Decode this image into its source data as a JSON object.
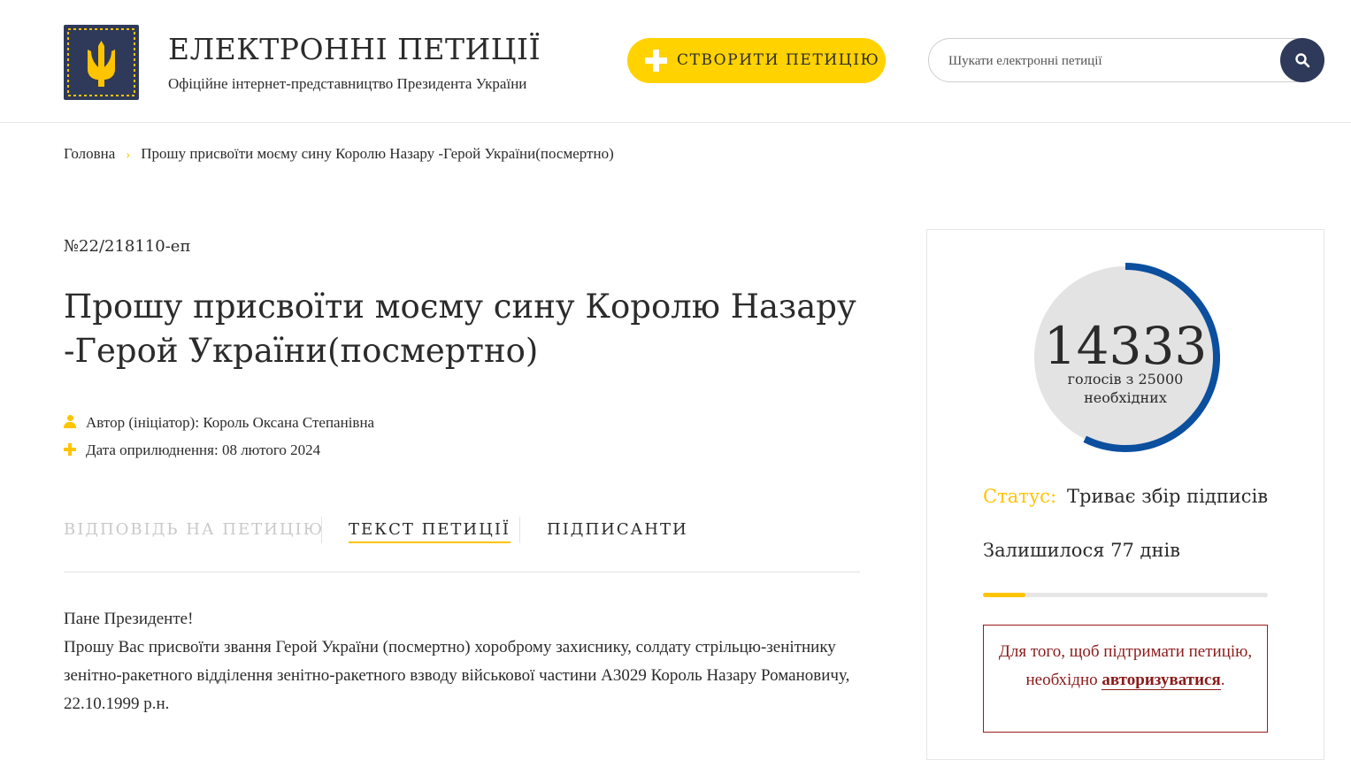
{
  "header": {
    "title": "ЕЛЕКТРОННІ ПЕТИЦІЇ",
    "subtitle": "Офіційне інтернет-представництво Президента України",
    "logo_icon": "trident-emblem-icon",
    "create_button_label": "СТВОРИТИ ПЕТИЦІЮ",
    "search": {
      "placeholder": "Шукати електронні петиції",
      "value": ""
    }
  },
  "breadcrumb": {
    "home": "Головна",
    "current": "Прошу присвоїти моєму сину Королю Назару -Герой України(посмертно)"
  },
  "petition": {
    "number": "№22/218110-еп",
    "title": "Прошу присвоїти моєму сину Королю Назару -Герой України(посмертно)",
    "author_label": "Автор (ініціатор):",
    "author_name": "Король Оксана Степанівна",
    "date_label": "Дата оприлюднення:",
    "date_value": "08 лютого 2024",
    "tabs": [
      {
        "label": "ВІДПОВІДЬ НА ПЕТИЦІЮ",
        "state": "disabled"
      },
      {
        "label": "ТЕКСТ ПЕТИЦІЇ",
        "state": "active"
      },
      {
        "label": "ПІДПИСАНТИ",
        "state": "normal"
      }
    ],
    "body_greeting": "Пане Президенте!",
    "body_text": "Прошу Вас присвоїти звання Герой України (посмертно) хороброму захиснику, солдату стрільцю-зенітнику зенітно-ракетного відділення зенітно-ракетного взводу військової частини А3029 Король Назару Романовичу, 22.10.1999 р.н."
  },
  "sidebar": {
    "votes": "14333",
    "votes_caption_line1": "голосів з 25000",
    "votes_caption_line2": "необхідних",
    "votes_current": 14333,
    "votes_required": 25000,
    "status_label": "Статус:",
    "status_value": "Триває збір підписів",
    "days_left_text": "Залишилося 77 днів",
    "time_progress_fraction": 0.15,
    "auth_text_before": "Для того, щоб підтримати петицію, необхідно",
    "auth_link": "авторизуватися",
    "auth_text_after": "."
  },
  "colors": {
    "accent_yellow": "#ffd200",
    "navy": "#2f3a5a",
    "gauge_blue": "#0b4f9e",
    "gauge_track": "#e3e3e3",
    "error_red": "#8b1a1a"
  }
}
